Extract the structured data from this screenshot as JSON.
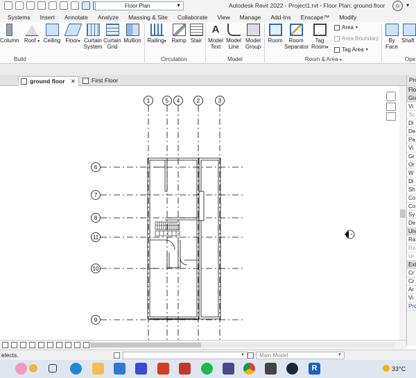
{
  "window": {
    "title": "Autodesk Revit 2022 - Project1.rvt - Floor Plan: ground floor",
    "view_selector": "Floor Plan",
    "user_icon": "user-icon"
  },
  "ribbon_tabs": [
    "Systems",
    "Insert",
    "Annotate",
    "Analyze",
    "Massing & Site",
    "Collaborate",
    "View",
    "Manage",
    "Add-Ins",
    "Enscape™",
    "Modify"
  ],
  "ribbon": {
    "build": {
      "label": "Build",
      "tools": [
        {
          "label": "Column",
          "icon": "column-icon"
        },
        {
          "label": "Roof",
          "icon": "roof-icon"
        },
        {
          "label": "Ceiling",
          "icon": "ceiling-icon"
        },
        {
          "label": "Floor",
          "icon": "floor-icon"
        },
        {
          "label": "Curtain System",
          "line1": "Curtain",
          "line2": "System",
          "icon": "curtain-system-icon"
        },
        {
          "label": "Curtain Grid",
          "line1": "Curtain",
          "line2": "Grid",
          "icon": "curtain-grid-icon"
        },
        {
          "label": "Mullion",
          "icon": "mullion-icon"
        }
      ]
    },
    "circulation": {
      "label": "Circulation",
      "tools": [
        {
          "label": "Railing",
          "icon": "railing-icon"
        },
        {
          "label": "Ramp",
          "icon": "ramp-icon"
        },
        {
          "label": "Stair",
          "icon": "stair-icon"
        }
      ]
    },
    "model": {
      "label": "Model",
      "tools": [
        {
          "label": "Model Text",
          "line1": "Model",
          "line2": "Text",
          "icon": "model-text-icon"
        },
        {
          "label": "Model Line",
          "line1": "Model",
          "line2": "Line",
          "icon": "model-line-icon"
        },
        {
          "label": "Model Group",
          "line1": "Model",
          "line2": "Group",
          "icon": "model-group-icon"
        }
      ]
    },
    "room_area": {
      "label": "Room & Area",
      "tools": [
        {
          "label": "Room",
          "icon": "room-icon"
        },
        {
          "label": "Room Separator",
          "line1": "Room",
          "line2": "Separator",
          "icon": "room-separator-icon"
        },
        {
          "label": "Tag Room",
          "line1": "Tag",
          "line2": "Room",
          "icon": "tag-room-icon"
        }
      ],
      "small": [
        {
          "label": "Area",
          "enabled": true
        },
        {
          "label": "Area Boundary",
          "enabled": false
        },
        {
          "label": "Tag Area",
          "enabled": true
        }
      ]
    },
    "opening": {
      "label": "Ope",
      "tools": [
        {
          "label": "By Face",
          "line1": "By",
          "line2": "Face",
          "icon": "by-face-icon"
        },
        {
          "label": "Shaft",
          "icon": "shaft-icon"
        }
      ]
    }
  },
  "doc_tabs": [
    {
      "label": "ground floor",
      "active": true,
      "close": "✕"
    },
    {
      "label": "First Floor",
      "active": false
    }
  ],
  "grids": {
    "vertical": [
      "1",
      "5",
      "4",
      "2",
      "3"
    ],
    "horizontal": [
      "6",
      "7",
      "8",
      "11",
      "10",
      "9"
    ]
  },
  "properties": {
    "header": "Pro",
    "rows": [
      {
        "text": "Flo",
        "kind": "grp"
      },
      {
        "text": "Gra",
        "kind": "grp"
      },
      {
        "text": "Vi",
        "kind": "normal"
      },
      {
        "text": "Sc",
        "kind": "dim"
      },
      {
        "text": "Di",
        "kind": "normal"
      },
      {
        "text": "De",
        "kind": "normal"
      },
      {
        "text": "Pa",
        "kind": "normal"
      },
      {
        "text": "Vi",
        "kind": "normal"
      },
      {
        "text": "Gr",
        "kind": "normal"
      },
      {
        "text": "Or",
        "kind": "normal"
      },
      {
        "text": "W",
        "kind": "normal"
      },
      {
        "text": "Di",
        "kind": "normal"
      },
      {
        "text": "Sh",
        "kind": "normal"
      },
      {
        "text": "Co",
        "kind": "normal"
      },
      {
        "text": "Co",
        "kind": "normal"
      },
      {
        "text": "Sy",
        "kind": "normal"
      },
      {
        "text": "De",
        "kind": "normal"
      },
      {
        "text": "Und",
        "kind": "grp"
      },
      {
        "text": "Ra",
        "kind": "normal"
      },
      {
        "text": "Ra",
        "kind": "dim"
      },
      {
        "text": "Ur",
        "kind": "dim"
      },
      {
        "text": "Ext",
        "kind": "grp"
      },
      {
        "text": "Cr",
        "kind": "normal"
      },
      {
        "text": "Cr",
        "kind": "normal"
      },
      {
        "text": "Ar",
        "kind": "normal"
      },
      {
        "text": "Vi",
        "kind": "normal"
      },
      {
        "text": "Pro",
        "kind": "link"
      }
    ]
  },
  "status": {
    "text": "elects.",
    "workset_value": "",
    "model_value": "Main Model"
  },
  "taskbar": {
    "apps": [
      "widgets-icon",
      "task-view-icon",
      "edge-icon",
      "file-explorer-icon",
      "store-icon",
      "vscode-like-icon",
      "office-icon",
      "pdf-icon",
      "spotify-icon",
      "video-icon",
      "chrome-icon",
      "camera-icon",
      "steam-icon",
      "revit-icon"
    ],
    "temperature": "33°C"
  }
}
